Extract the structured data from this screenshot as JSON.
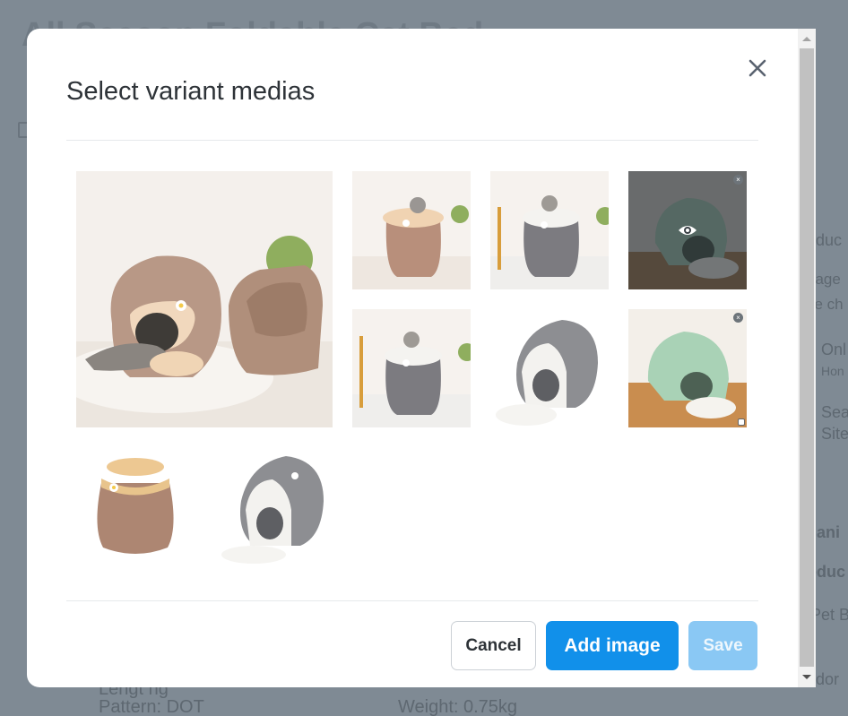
{
  "background": {
    "title": "All Season Foldable Cat Bed",
    "right_fragments": [
      "oduc",
      "nage",
      "se ch",
      "Onl",
      "Hon",
      "Sea",
      "Site",
      "gani",
      "oduc",
      "Pet B",
      "ndor"
    ],
    "bottom_left": "Pattern: DOT",
    "bottom_left_partial": "Lengt   ng",
    "bottom_right": "Weight: 0.75kg"
  },
  "modal": {
    "title": "Select variant medias",
    "close_icon": "close-icon",
    "media": [
      {
        "desc": "beige-and-brown-cat-beds-with-cat",
        "selected": false
      },
      {
        "desc": "brown-honey-pot-bed-with-cat",
        "selected": false
      },
      {
        "desc": "grey-honey-pot-bed-with-cat",
        "selected": false
      },
      {
        "desc": "green-bed-hover-preview",
        "selected": false,
        "hovered": true
      },
      {
        "desc": "grey-honey-pot-bed-with-cat-2",
        "selected": false
      },
      {
        "desc": "grey-bed-with-cushion",
        "selected": false
      },
      {
        "desc": "green-bed-on-wood-floor",
        "selected": false
      },
      {
        "desc": "brown-honey-pot-bed",
        "selected": false
      },
      {
        "desc": "grey-bed-with-cushion-2",
        "selected": false
      }
    ],
    "buttons": {
      "cancel": "Cancel",
      "add_image": "Add image",
      "save": "Save"
    }
  },
  "colors": {
    "primary": "#1190ea",
    "primary_disabled": "#8ac8f4",
    "overlay": "#7f8a94"
  }
}
